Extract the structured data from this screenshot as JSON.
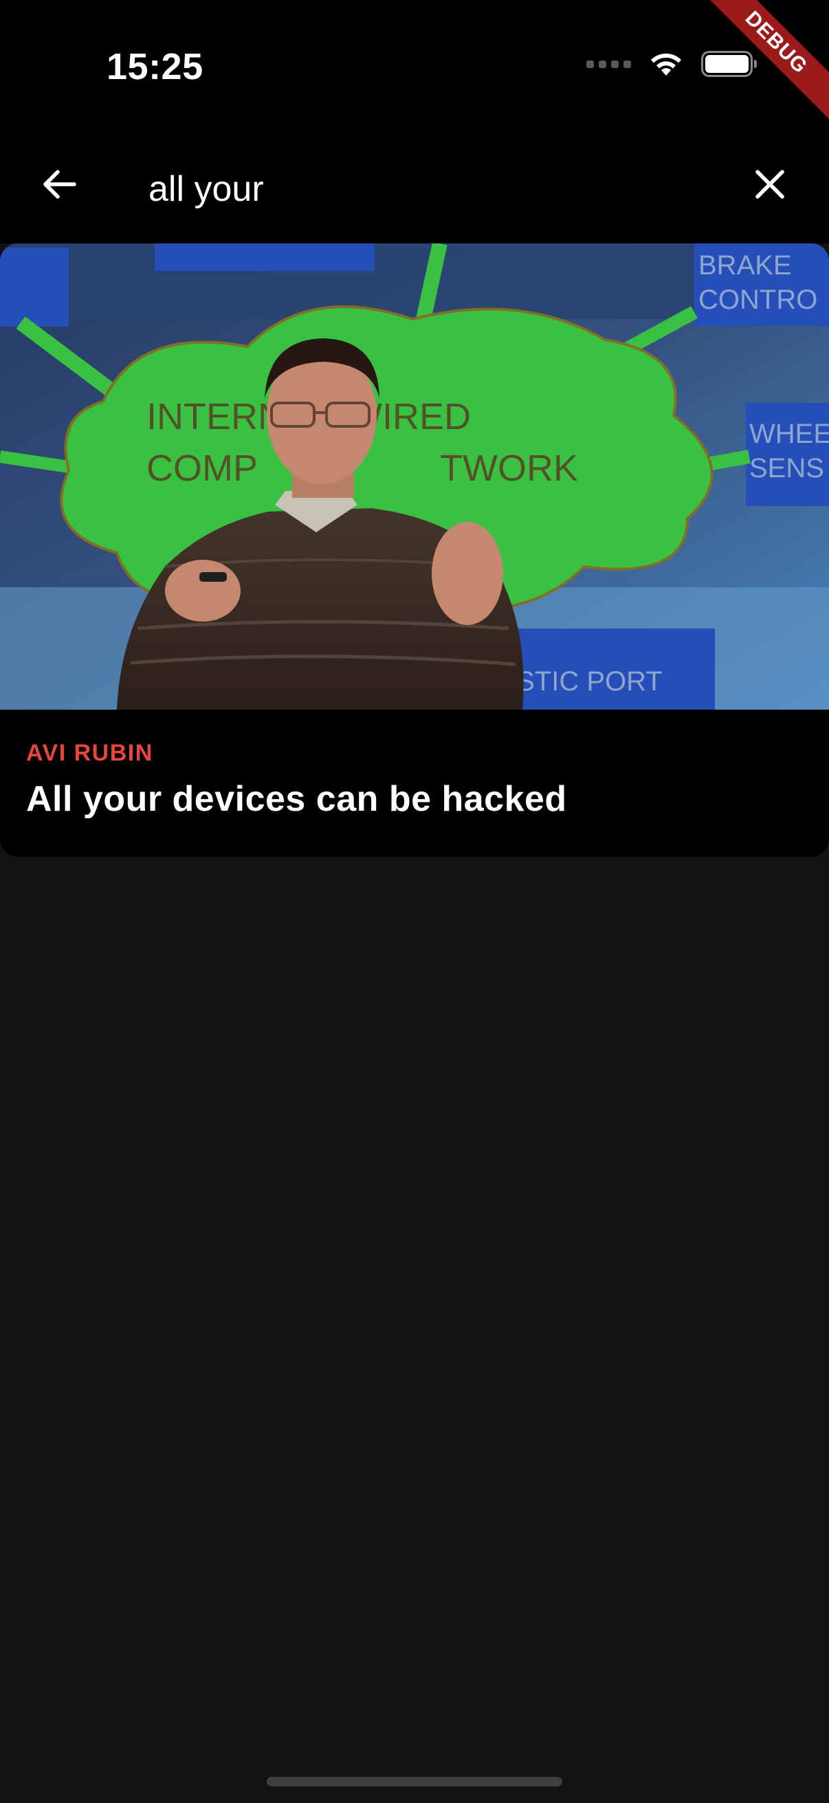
{
  "status_bar": {
    "time": "15:25",
    "debug_label": "DEBUG"
  },
  "search": {
    "query": "all your"
  },
  "results": [
    {
      "speaker": "AVI RUBIN",
      "title": "All your devices can be hacked",
      "image_text": [
        "INTERN",
        "WIRED",
        "COMP",
        "TWORK",
        "BRAKE",
        "CONTRO",
        "WHEE",
        "SENS",
        "GNOSTIC PORT"
      ]
    }
  ],
  "colors": {
    "accent": "#e8463a",
    "background": "#121212",
    "bar": "#000000",
    "debug": "#9b1a1a"
  },
  "icons": {
    "back": "arrow-left-icon",
    "clear": "close-icon",
    "wifi": "wifi-icon",
    "battery": "battery-icon"
  }
}
